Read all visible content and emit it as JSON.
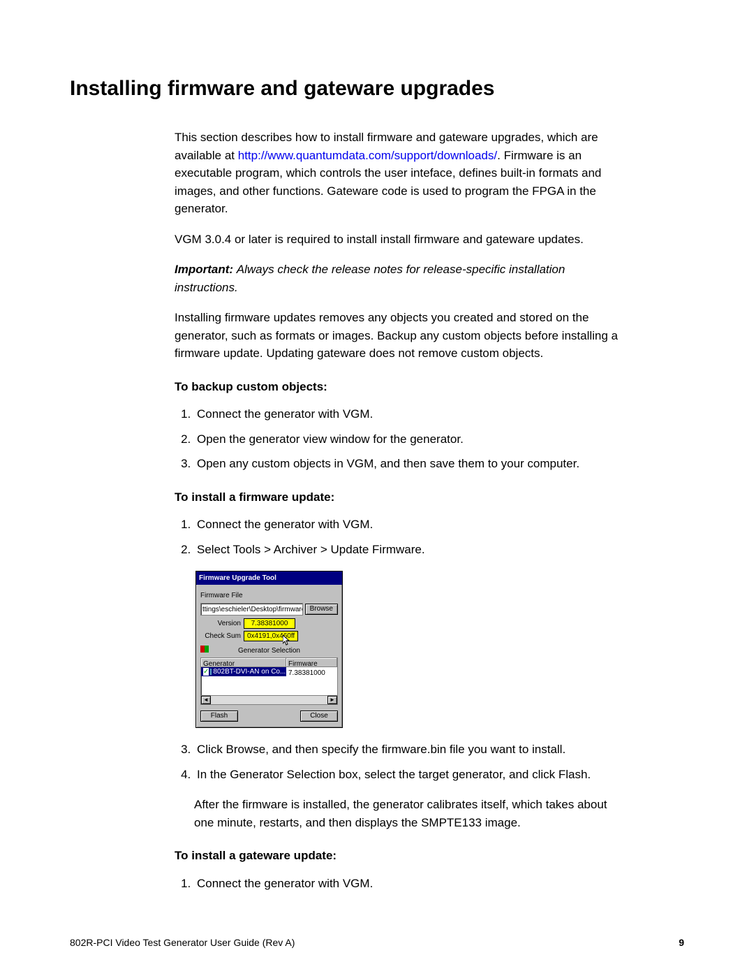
{
  "title": "Installing firmware and gateware upgrades",
  "intro": {
    "part1": "This section describes how to install firmware and gateware upgrades, which are available at ",
    "link_text": "http://www.quantumdata.com/support/downloads/",
    "part2": ". Firmware is an executable program, which controls the user inteface, defines built-in formats and images, and other functions. Gateware code is used to program the FPGA in the generator."
  },
  "req_line": "VGM 3.0.4 or later is required to install install firmware and gateware updates.",
  "important": {
    "label": "Important:  ",
    "text": "Always check the release notes for release-specific installation instructions."
  },
  "removal_para": "Installing firmware updates removes any objects you created and stored on the generator, such as formats or images. Backup any custom objects before installing a firmware update. Updating gateware does not remove custom objects.",
  "backup": {
    "heading": "To backup custom objects:",
    "steps": [
      "Connect the generator with VGM.",
      "Open the generator view window for the generator.",
      "Open any custom objects in VGM, and then save them to your computer."
    ]
  },
  "firmware": {
    "heading": "To install a firmware update:",
    "steps_before": [
      "Connect the generator with VGM.",
      "Select Tools > Archiver > Update Firmware."
    ],
    "steps_after": [
      "Click Browse, and then specify the firmware.bin file you want to install.",
      "In the Generator Selection box, select the target generator, and click Flash."
    ],
    "after_note": "After the firmware is installed, the generator calibrates itself, which takes about one minute, restarts, and then displays the SMPTE133 image."
  },
  "gateware": {
    "heading": "To install a gateware update:",
    "steps": [
      "Connect the generator with VGM."
    ]
  },
  "dialog": {
    "title": "Firmware Upgrade Tool",
    "file_label": "Firmware File",
    "file_path": "ttings\\eschieler\\Desktop\\firmware.bin",
    "browse": "Browse",
    "version_label": "Version",
    "version_value": "7.38381000",
    "checksum_label": "Check Sum",
    "checksum_value": "0x4191,0x460ff",
    "gensel_label": "Generator Selection",
    "col_generator": "Generator",
    "col_firmware": "Firmware",
    "row_generator": "802BT-DVI-AN on Co...",
    "row_firmware": "7.38381000",
    "flash": "Flash",
    "close": "Close"
  },
  "footer": {
    "guide": "802R-PCI Video Test Generator User Guide (Rev A)",
    "page": "9"
  }
}
